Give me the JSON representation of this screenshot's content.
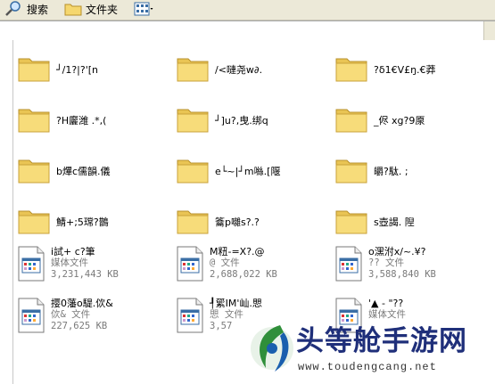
{
  "toolbar": {
    "search_label": "搜索",
    "folders_label": "文件夹"
  },
  "items": [
    {
      "type": "folder",
      "name": "┘/1?|?'[n"
    },
    {
      "type": "folder",
      "name": "/<嗹尧w∂."
    },
    {
      "type": "folder",
      "name": "?δ1€V£ŋ.€莽"
    },
    {
      "type": "folder",
      "name": "?H廲潍 .*,("
    },
    {
      "type": "folder",
      "name": "┘]u?,曳.绑q"
    },
    {
      "type": "folder",
      "name": "_侭  xg?9厡"
    },
    {
      "type": "folder",
      "name": "b熚c儒韻.儀"
    },
    {
      "type": "folder",
      "name": "e└~|┘m噝.[隁"
    },
    {
      "type": "folder",
      "name": "皭?駄. ;"
    },
    {
      "type": "folder",
      "name": "鯖+;5瑺?鵲"
    },
    {
      "type": "folder",
      "name": "籥p囃s?.?"
    },
    {
      "type": "folder",
      "name": "s壺謁. 隉"
    },
    {
      "type": "file",
      "name": "i試+  c?筆",
      "kind": "媒体文件",
      "size": "3,231,443 KB"
    },
    {
      "type": "file",
      "name": "M粈-=X?.@",
      "kind": "@   文件",
      "size": "2,688,022 KB"
    },
    {
      "type": "file",
      "name": "o潶泭x/~.¥?",
      "kind": "?? 文件",
      "size": "3,588,840 KB"
    },
    {
      "type": "file",
      "name": "撄0藩o騠.佽&",
      "kind": "佽& 文件",
      "size": "227,625 KB"
    },
    {
      "type": "file",
      "name": "┦綤IM'屾.愳",
      "kind": "愳 文件",
      "size": "3,57"
    },
    {
      "type": "file",
      "name": "'▲ -   \"??",
      "kind": "媒体文件",
      "size": ""
    }
  ],
  "watermark": {
    "title": "头等舱手游网",
    "url": "www.toudengcang.net"
  }
}
